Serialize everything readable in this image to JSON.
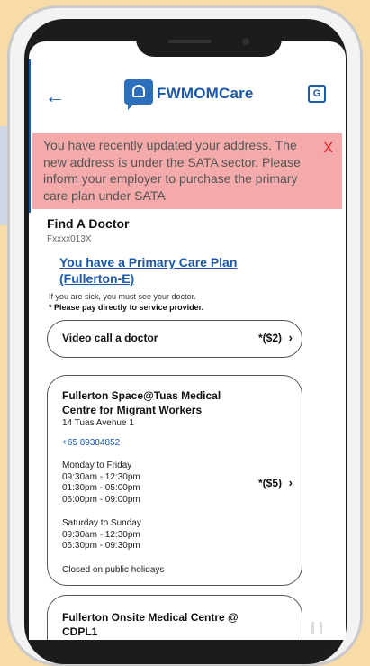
{
  "header": {
    "app_title": "FWMOMCare",
    "translate_label": "G"
  },
  "alert": {
    "message": "You have recently updated your address. The new address is under the SATA sector. Please inform your employer to purchase the primary care plan under  SATA",
    "close_label": "X"
  },
  "find_doctor": {
    "title": "Find A Doctor",
    "fin": "Fxxxx013X",
    "plan_link": "You have a Primary Care Plan (Fullerton-E)",
    "sick_note": "If you are sick, you must see your doctor.",
    "pay_note": "* Please pay directly to service provider."
  },
  "video_call": {
    "label": "Video call a doctor",
    "fee": "*($2)",
    "chevron": "›"
  },
  "clinics": [
    {
      "name": "Fullerton Space@Tuas Medical Centre for Migrant Workers",
      "address": "14 Tuas Avenue 1",
      "phone": "+65 89384852",
      "weekday_label": "Monday to Friday",
      "weekday_slots": [
        "09:30am - 12:30pm",
        "01:30pm - 05:00pm",
        "06:00pm - 09:00pm"
      ],
      "weekend_label": "Saturday to Sunday",
      "weekend_slots": [
        "09:30am - 12:30pm",
        "06:30pm - 09:30pm"
      ],
      "holiday_note": "Closed on public holidays",
      "fee": "*($5)",
      "chevron": "›"
    },
    {
      "name": "Fullerton Onsite Medical Centre @ CDPL1"
    }
  ],
  "icons": {
    "back": "back-arrow-icon",
    "logo": "doctor-chat-logo-icon",
    "translate": "translate-icon"
  },
  "colors": {
    "brand_blue": "#1b58a8",
    "alert_bg": "#f4aaaa",
    "alert_close": "#e02020"
  }
}
